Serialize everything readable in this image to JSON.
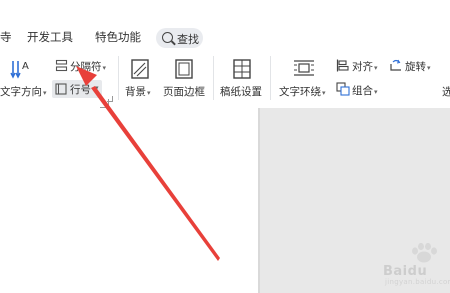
{
  "tabs": {
    "partial_left": "寺",
    "developer": "开发工具",
    "features": "特色功能",
    "search": "查找"
  },
  "ribbon": {
    "text_direction": "文字方向",
    "separator": "分隔符",
    "line_number": "行号",
    "background": "背景",
    "page_border": "页面边框",
    "manuscript": "稿纸设置",
    "text_wrap": "文字环绕",
    "align": "对齐",
    "rotate": "旋转",
    "group": "组合",
    "partial_right": "选"
  },
  "watermark": {
    "text": "Baidu",
    "sub": "jingyan.baidu.com"
  },
  "colors": {
    "arrow": "#e8403a",
    "accent_blue": "#2f6fd6"
  }
}
